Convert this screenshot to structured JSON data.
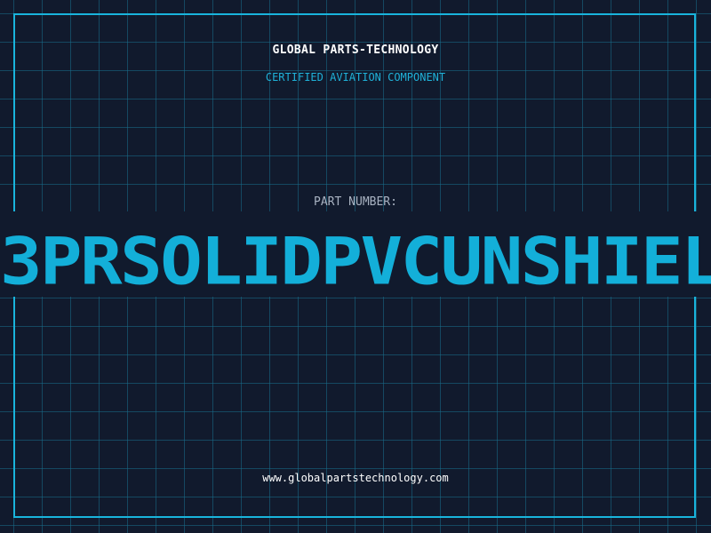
{
  "header": {
    "brand": "GLOBAL PARTS-TECHNOLOGY",
    "subtitle": "CERTIFIED AVIATION COMPONENT"
  },
  "part": {
    "label": "PART NUMBER:",
    "number": "3PRSOLIDPVCUNSHIEL"
  },
  "footer": {
    "url": "www.globalpartstechnology.com"
  },
  "colors": {
    "background": "#111a2d",
    "grid": "#186e8c",
    "accent": "#19b4dc",
    "text": "#ffffff"
  }
}
